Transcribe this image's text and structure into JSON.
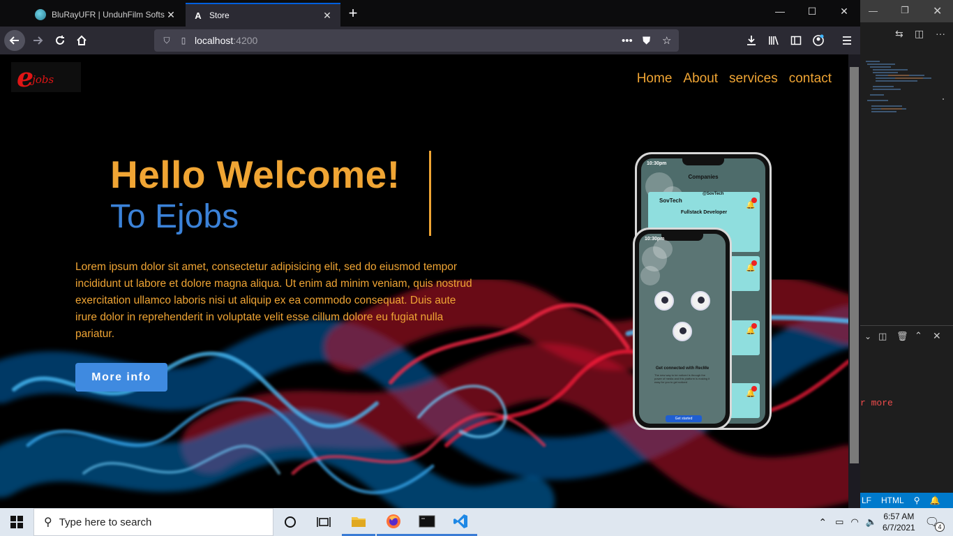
{
  "browser": {
    "tabs": [
      {
        "title": "BluRayUFR | UnduhFilm Softsub"
      },
      {
        "title": "Store",
        "favicon": "A"
      }
    ],
    "url_host": "localhost",
    "url_port": ":4200"
  },
  "page": {
    "logo_e": "e",
    "logo_jobs": "jobs",
    "nav": [
      "Home",
      "About",
      "services",
      "contact"
    ],
    "hero_line1": "Hello Welcome!",
    "hero_line2": "To Ejobs",
    "paragraph": "Lorem ipsum dolor sit amet, consectetur adipisicing elit, sed do eiusmod tempor incididunt ut labore et dolore magna aliqua. Ut enim ad minim veniam, quis nostrud exercitation ullamco laboris nisi ut aliquip ex ea commodo consequat. Duis aute irure dolor in reprehenderit in voluptate velit esse cillum dolore eu fugiat nulla pariatur.",
    "cta": "More info",
    "colors": {
      "accent": "#f0a534",
      "blue": "#3b82d8",
      "button": "#3f8ae0"
    },
    "phone_back": {
      "time": "10:30pm",
      "title": "Companies",
      "handle": "@SovTech",
      "company": "SovTech",
      "job": "Fullstack Developer"
    },
    "phone_front": {
      "time": "10:30pm",
      "heading": "Get connected with RecMe",
      "body": "The new way to be noticed is through the power of media and this platform is making it easy for you to get noticed",
      "button": "Get started"
    }
  },
  "vscode": {
    "more_text": "r more",
    "status": [
      "LF",
      "HTML"
    ]
  },
  "taskbar": {
    "search_placeholder": "Type here to search",
    "time": "6:57 AM",
    "date": "6/7/2021",
    "notifications": "4"
  }
}
